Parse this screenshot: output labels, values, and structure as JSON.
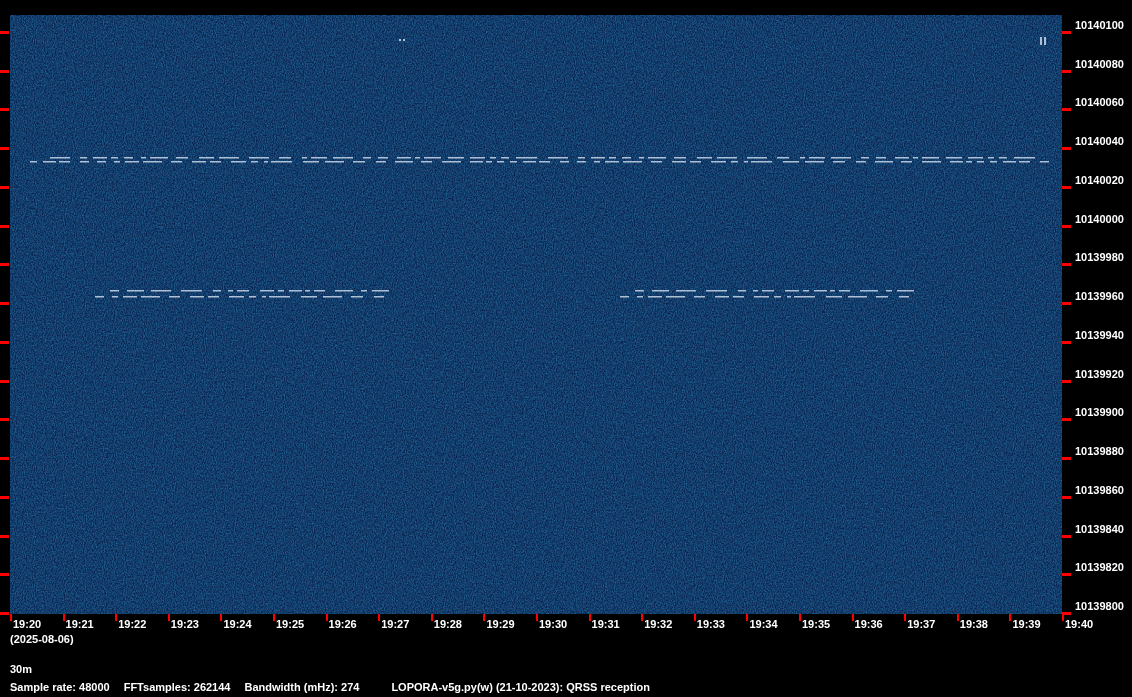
{
  "frequency_axis": {
    "labels": [
      "10140100",
      "10140080",
      "10140060",
      "10140040",
      "10140020",
      "10140000",
      "10139980",
      "10139960",
      "10139940",
      "10139920",
      "10139900",
      "10139880",
      "10139860",
      "10139840",
      "10139820",
      "10139800"
    ]
  },
  "time_axis": {
    "labels": [
      "19:20",
      "19:21",
      "19:22",
      "19:23",
      "19:24",
      "19:25",
      "19:26",
      "19:27",
      "19:28",
      "19:29",
      "19:30",
      "19:31",
      "19:32",
      "19:33",
      "19:34",
      "19:35",
      "19:36",
      "19:37",
      "19:38",
      "19:39",
      "19:40"
    ],
    "date": "(2025-08-06)"
  },
  "band": "30m",
  "info": [
    "Sample rate: 48000",
    "FFTsamples: 262144",
    "Bandwidth (mHz): 274",
    "LOPORA-v5g.py(w) (21-10-2023): QRSS reception"
  ]
}
